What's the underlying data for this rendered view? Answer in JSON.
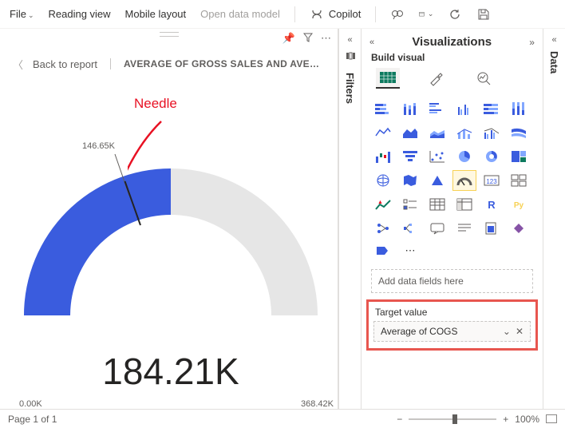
{
  "topbar": {
    "file": "File",
    "reading_view": "Reading view",
    "mobile_layout": "Mobile layout",
    "open_data_model": "Open data model",
    "copilot": "Copilot"
  },
  "breadcrumb": {
    "back": "Back to report",
    "title": "AVERAGE OF GROSS SALES AND AVERAG..."
  },
  "annotation": {
    "needle": "Needle"
  },
  "chart_data": {
    "type": "gauge",
    "value_label": "184.21K",
    "min_label": "0.00K",
    "max_label": "368.42K",
    "needle_label": "146.65K",
    "value": 184.21,
    "min": 0.0,
    "max": 368.42,
    "needle": 146.65,
    "fill_fraction": 0.5,
    "needle_fraction": 0.398,
    "primary_color": "#3a5cde"
  },
  "panes": {
    "filters": "Filters",
    "visualizations": "Visualizations",
    "build": "Build visual",
    "data": "Data"
  },
  "fields": {
    "add_placeholder": "Add data fields here",
    "target_label": "Target value",
    "target_pill": "Average of COGS"
  },
  "status": {
    "page": "Page 1 of 1",
    "zoom": "100%"
  }
}
